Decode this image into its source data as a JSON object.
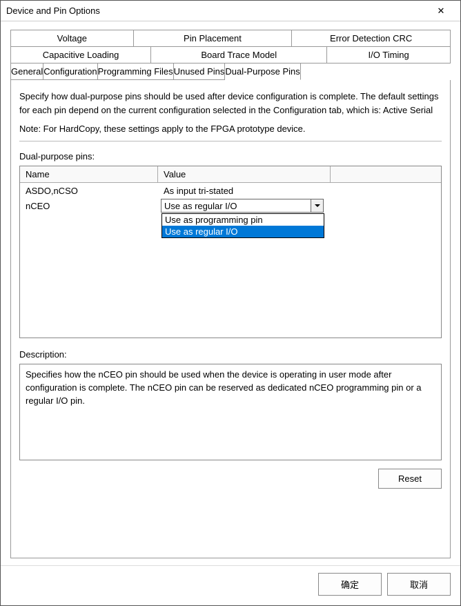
{
  "window": {
    "title": "Device and Pin Options",
    "close_glyph": "✕"
  },
  "tabs": {
    "row1": [
      "Voltage",
      "Pin Placement",
      "Error Detection CRC"
    ],
    "row2": [
      "Capacitive Loading",
      "Board Trace Model",
      "I/O Timing"
    ],
    "row3": [
      "General",
      "Configuration",
      "Programming Files",
      "Unused Pins",
      "Dual-Purpose Pins"
    ],
    "active": "Dual-Purpose Pins"
  },
  "panel": {
    "intro": "Specify how dual-purpose pins should be used after device configuration is complete. The default settings for each pin depend on the current configuration selected in the Configuration tab, which is:  Active Serial",
    "note": "Note: For HardCopy, these settings apply to the FPGA prototype device.",
    "section_label": "Dual-purpose pins:",
    "columns": {
      "name": "Name",
      "value": "Value"
    },
    "rows": [
      {
        "name": "ASDO,nCSO",
        "value": "As input tri-stated"
      },
      {
        "name": "nCEO",
        "value": "Use as regular I/O"
      }
    ],
    "dropdown": {
      "options": [
        "Use as programming pin",
        "Use as regular I/O"
      ],
      "highlighted": "Use as regular I/O"
    },
    "description_label": "Description:",
    "description": "Specifies how the nCEO pin should be used when the device is operating in user mode after configuration is complete. The nCEO pin can be reserved as dedicated nCEO programming pin or a regular I/O pin.",
    "reset_label": "Reset"
  },
  "buttons": {
    "ok": "确定",
    "cancel": "取消"
  }
}
